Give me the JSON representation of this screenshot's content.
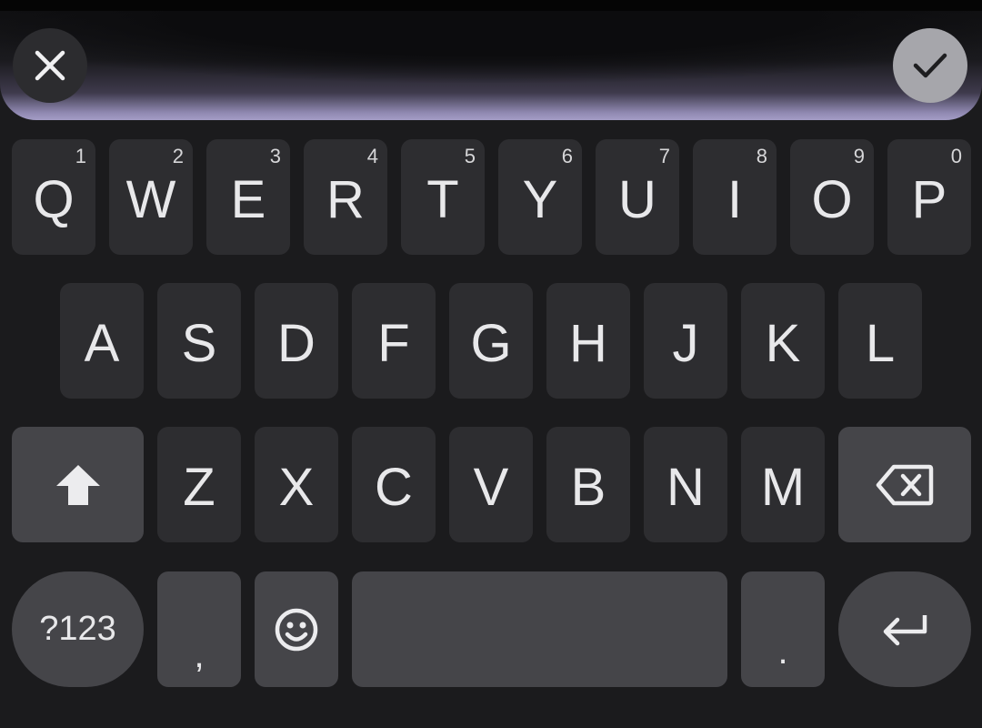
{
  "keyboard": {
    "row1": [
      {
        "key": "Q",
        "hint": "1"
      },
      {
        "key": "W",
        "hint": "2"
      },
      {
        "key": "E",
        "hint": "3"
      },
      {
        "key": "R",
        "hint": "4"
      },
      {
        "key": "T",
        "hint": "5"
      },
      {
        "key": "Y",
        "hint": "6"
      },
      {
        "key": "U",
        "hint": "7"
      },
      {
        "key": "I",
        "hint": "8"
      },
      {
        "key": "O",
        "hint": "9"
      },
      {
        "key": "P",
        "hint": "0"
      }
    ],
    "row2": [
      "A",
      "S",
      "D",
      "F",
      "G",
      "H",
      "J",
      "K",
      "L"
    ],
    "row3": [
      "Z",
      "X",
      "C",
      "V",
      "B",
      "N",
      "M"
    ],
    "bottom": {
      "symbols_label": "?123",
      "comma": ",",
      "period": "."
    },
    "icons": {
      "close": "close-icon",
      "done": "checkmark-icon",
      "shift": "shift-arrow-icon",
      "backspace": "backspace-icon",
      "emoji": "smiley-icon",
      "enter": "enter-arrow-icon"
    },
    "colors": {
      "background": "#1b1b1d",
      "key": "#2d2d30",
      "function_key": "#454549",
      "voice_glow": "#a49dc6",
      "done_button": "#a6a6ab"
    }
  }
}
